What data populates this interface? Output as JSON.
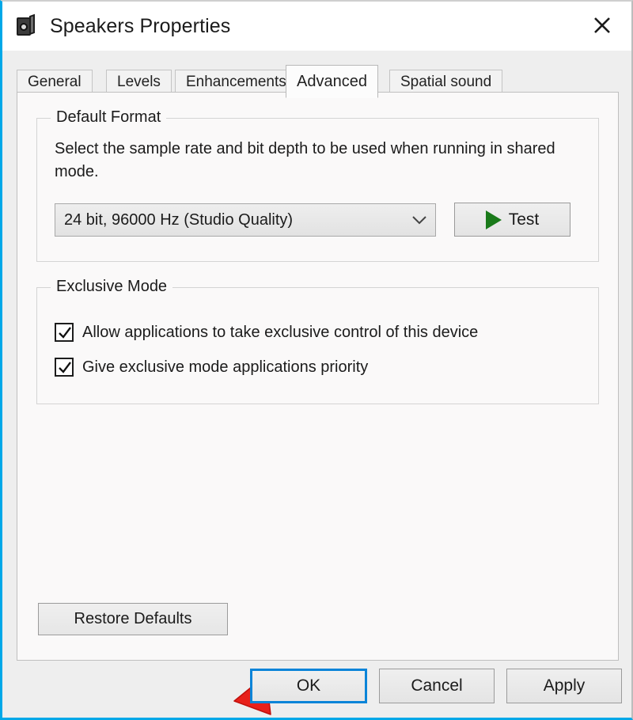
{
  "window": {
    "title": "Speakers Properties",
    "icon": "speaker-icon",
    "close_icon": "close-icon",
    "accent_color": "#00a8e8",
    "titlebar_bg": "#ffffff",
    "body_bg": "#eeeeee"
  },
  "tabs": [
    {
      "label": "General",
      "selected": false
    },
    {
      "label": "Levels",
      "selected": false
    },
    {
      "label": "Enhancements",
      "selected": false
    },
    {
      "label": "Advanced",
      "selected": true
    },
    {
      "label": "Spatial sound",
      "selected": false
    }
  ],
  "default_format": {
    "group_label": "Default Format",
    "description": "Select the sample rate and bit depth to be used when running in shared mode.",
    "combo_value": "24 bit, 96000 Hz (Studio Quality)",
    "combo_arrow_icon": "chevron-down-icon",
    "test_button_label": "Test",
    "test_play_icon": "play-triangle-icon",
    "test_play_color": "#1a7a1a"
  },
  "exclusive_mode": {
    "group_label": "Exclusive Mode",
    "checkboxes": [
      {
        "label": "Allow applications to take exclusive control of this device",
        "checked": true
      },
      {
        "label": "Give exclusive mode applications priority",
        "checked": true
      }
    ]
  },
  "restore_defaults": {
    "label": "Restore Defaults"
  },
  "annotation": {
    "icon": "red-arrow-left-icon",
    "color": "#e8201a",
    "points_to": "Restore Defaults"
  },
  "footer": {
    "ok_label": "OK",
    "cancel_label": "Cancel",
    "apply_label": "Apply",
    "default_button": "OK",
    "focus_color": "#0a84d8"
  }
}
